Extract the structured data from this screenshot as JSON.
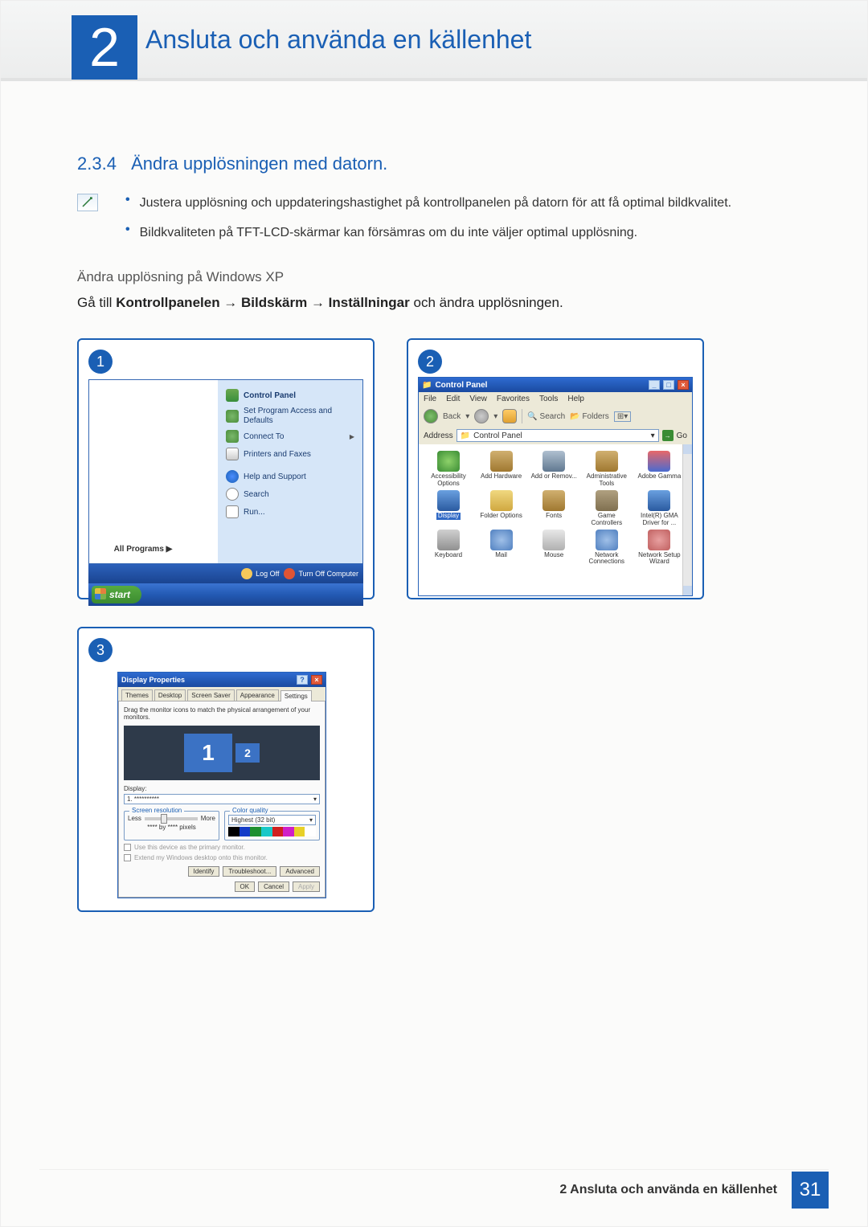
{
  "chapter": {
    "number": "2",
    "title": "Ansluta och använda en källenhet"
  },
  "section": {
    "number": "2.3.4",
    "title": "Ändra upplösningen med datorn."
  },
  "bullets": [
    "Justera upplösning och uppdateringshastighet på kontrollpanelen på datorn för att få optimal bildkvalitet.",
    "Bildkvaliteten på TFT-LCD-skärmar kan försämras om du inte väljer optimal upplösning."
  ],
  "subheading": "Ändra upplösning på Windows XP",
  "instruction": {
    "prefix": "Gå till ",
    "path": "Kontrollpanelen → Bildskärm → Inställningar",
    "suffix": " och ändra upplösningen."
  },
  "step1": {
    "badge": "1",
    "start_menu": {
      "control_panel": "Control Panel",
      "set_program_access": "Set Program Access and Defaults",
      "connect_to": "Connect To",
      "printers_faxes": "Printers and Faxes",
      "help_support": "Help and Support",
      "search": "Search",
      "run": "Run...",
      "all_programs": "All Programs",
      "log_off": "Log Off",
      "turn_off": "Turn Off Computer",
      "start_btn": "start"
    }
  },
  "step2": {
    "badge": "2",
    "window": {
      "title": "Control Panel",
      "menu": [
        "File",
        "Edit",
        "View",
        "Favorites",
        "Tools",
        "Help"
      ],
      "toolbar": {
        "back": "Back",
        "search": "Search",
        "folders": "Folders"
      },
      "address_label": "Address",
      "address_value": "Control Panel",
      "go": "Go",
      "icons": [
        {
          "label": "Accessibility Options"
        },
        {
          "label": "Add Hardware"
        },
        {
          "label": "Add or Remov..."
        },
        {
          "label": "Administrative Tools"
        },
        {
          "label": "Adobe Gamma"
        },
        {
          "label": "Display",
          "selected": true
        },
        {
          "label": "Folder Options"
        },
        {
          "label": "Fonts"
        },
        {
          "label": "Game Controllers"
        },
        {
          "label": "Intel(R) GMA Driver for ..."
        },
        {
          "label": "Keyboard"
        },
        {
          "label": "Mail"
        },
        {
          "label": "Mouse"
        },
        {
          "label": "Network Connections"
        },
        {
          "label": "Network Setup Wizard"
        }
      ]
    }
  },
  "step3": {
    "badge": "3",
    "dialog": {
      "title": "Display Properties",
      "tabs": [
        "Themes",
        "Desktop",
        "Screen Saver",
        "Appearance",
        "Settings"
      ],
      "active_tab": "Settings",
      "drag_note": "Drag the monitor icons to match the physical arrangement of your monitors.",
      "monitor1": "1",
      "monitor2": "2",
      "display_label": "Display:",
      "display_value": "1. **********",
      "screen_res_title": "Screen resolution",
      "less": "Less",
      "more": "More",
      "pixels": "**** by **** pixels",
      "color_quality_title": "Color quality",
      "color_quality_value": "Highest (32 bit)",
      "chk1": "Use this device as the primary monitor.",
      "chk2": "Extend my Windows desktop onto this monitor.",
      "identify": "Identify",
      "troubleshoot": "Troubleshoot...",
      "advanced": "Advanced",
      "ok": "OK",
      "cancel": "Cancel",
      "apply": "Apply"
    }
  },
  "footer": {
    "chapter_text": "2 Ansluta och använda en källenhet",
    "page": "31"
  }
}
